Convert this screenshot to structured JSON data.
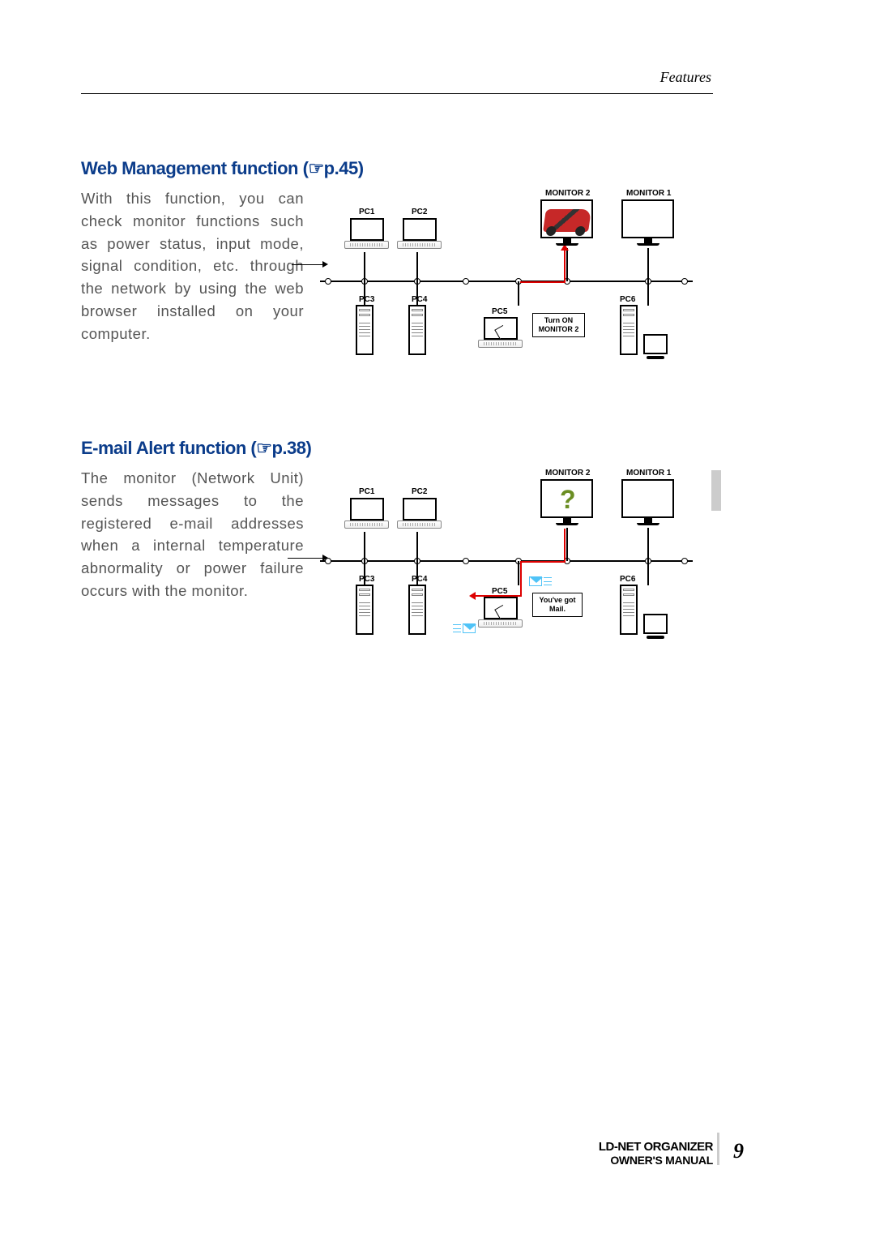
{
  "header": {
    "section_name": "Features"
  },
  "sections": [
    {
      "title_prefix": "Web Management function (",
      "title_page_ref": "p.45)",
      "body": "With this function, you can check monitor functions such as power status, input mode, signal condition, etc. through the network by using the web browser installed on your computer.",
      "diagram": {
        "labels": {
          "pc1": "PC1",
          "pc2": "PC2",
          "pc3": "PC3",
          "pc4": "PC4",
          "pc5": "PC5",
          "pc6": "PC6",
          "monitor1": "MONITOR 1",
          "monitor2": "MONITOR 2"
        },
        "callout": "Turn ON\nMONITOR 2"
      }
    },
    {
      "title_prefix": "E-mail Alert function (",
      "title_page_ref": "p.38)",
      "body": "The monitor (Network Unit) sends messages to the registered e-mail addresses when a internal temperature abnormality or power failure occurs with the monitor.",
      "diagram": {
        "labels": {
          "pc1": "PC1",
          "pc2": "PC2",
          "pc3": "PC3",
          "pc4": "PC4",
          "pc5": "PC5",
          "pc6": "PC6",
          "monitor1": "MONITOR 1",
          "monitor2": "MONITOR 2"
        },
        "callout": "You've got\nMail."
      }
    }
  ],
  "footer": {
    "product": "LD-NET ORGANIZER",
    "manual": "OWNER'S MANUAL",
    "page_number": "9"
  }
}
